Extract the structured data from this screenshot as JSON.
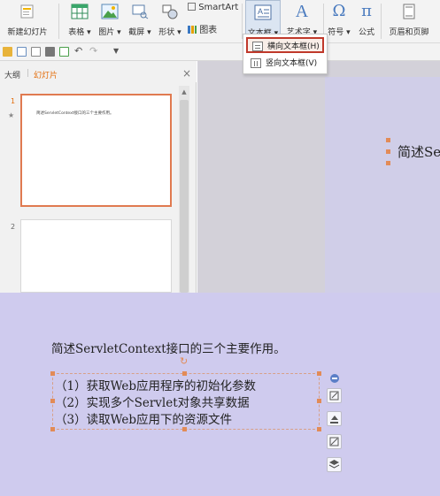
{
  "ribbon": {
    "new_slide": "新建幻灯片",
    "table": "表格",
    "picture": "图片",
    "screenshot": "截屏",
    "shapes": "形状",
    "smartart": "SmartArt",
    "chart": "图表",
    "textbox": "文本框",
    "wordart": "艺术字",
    "symbol": "符号",
    "formula": "公式",
    "header_footer": "页眉和页脚"
  },
  "dropdown": {
    "items": [
      {
        "label": "横向文本框(H)",
        "selected": true
      },
      {
        "label": "竖向文本框(V)",
        "selected": false
      }
    ]
  },
  "panel": {
    "tab_outline": "大纲",
    "tab_slides": "幻灯片",
    "close": "×",
    "slide1_number": "1",
    "slide1_star": "★",
    "slide1_text": "简述ServletContext接口的三个主要作用。",
    "slide2_number": "2"
  },
  "slide_top": {
    "title_partial": "简述Se"
  },
  "slide_bottom": {
    "title": "简述ServletContext接口的三个主要作用。",
    "lines": [
      "（1）获取Web应用程序的初始化参数",
      "（2）实现多个Servlet对象共享数据",
      "（3）读取Web应用下的资源文件"
    ]
  },
  "colors": {
    "accent_red": "#c0392b",
    "slide_tab_orange": "#e36c09",
    "thumb_border": "#e07a50",
    "handle": "#e28b57",
    "slide_bg": "#cfcbee"
  }
}
